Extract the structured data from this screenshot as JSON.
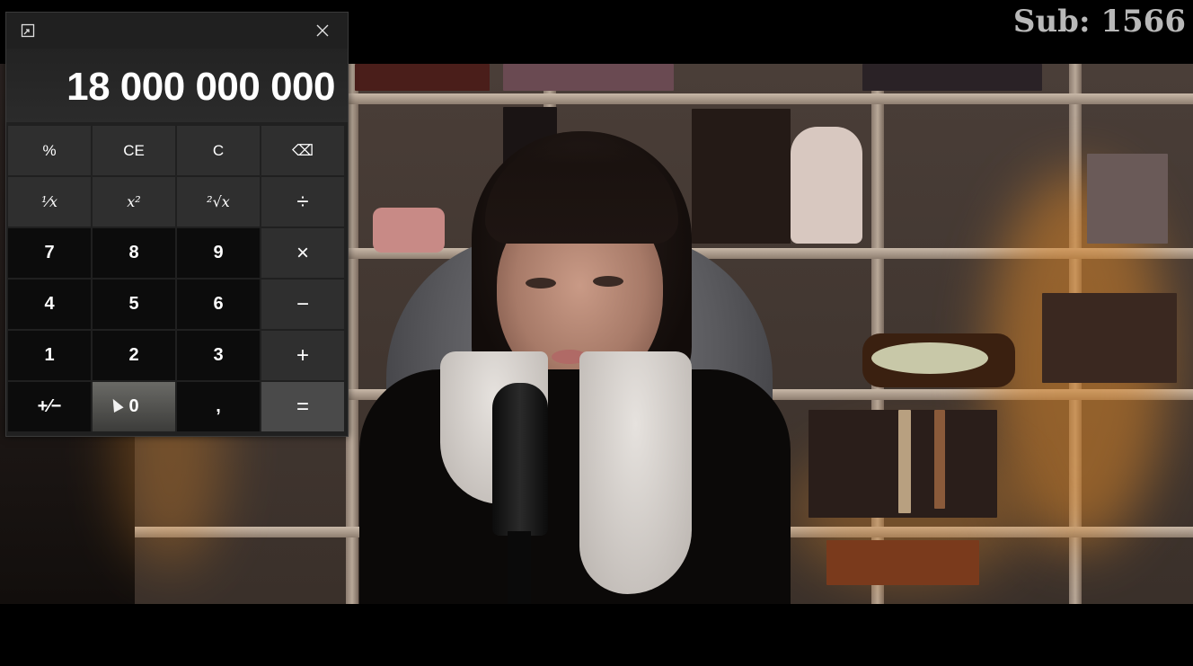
{
  "calculator": {
    "display_value": "18 000 000 000",
    "titlebar_icons": {
      "keep_on_top": "keep-on-top-icon",
      "close": "close-icon"
    },
    "keys": [
      {
        "id": "percent",
        "label": "%"
      },
      {
        "id": "clear-entry",
        "label": "CE"
      },
      {
        "id": "clear",
        "label": "C"
      },
      {
        "id": "backspace",
        "label": "⌫"
      },
      {
        "id": "reciprocal",
        "label": "¹⁄x"
      },
      {
        "id": "square",
        "label": "x²"
      },
      {
        "id": "square-root",
        "label": "²√x"
      },
      {
        "id": "divide",
        "label": "÷"
      },
      {
        "id": "7",
        "label": "7"
      },
      {
        "id": "8",
        "label": "8"
      },
      {
        "id": "9",
        "label": "9"
      },
      {
        "id": "multiply",
        "label": "×"
      },
      {
        "id": "4",
        "label": "4"
      },
      {
        "id": "5",
        "label": "5"
      },
      {
        "id": "6",
        "label": "6"
      },
      {
        "id": "subtract",
        "label": "−"
      },
      {
        "id": "1",
        "label": "1"
      },
      {
        "id": "2",
        "label": "2"
      },
      {
        "id": "3",
        "label": "3"
      },
      {
        "id": "add",
        "label": "+"
      },
      {
        "id": "negate",
        "label": "+⁄−"
      },
      {
        "id": "0",
        "label": "0"
      },
      {
        "id": "decimal",
        "label": ","
      },
      {
        "id": "equals",
        "label": "="
      }
    ]
  },
  "overlay": {
    "sub_label": "Sub:",
    "sub_count": "1566"
  },
  "colors": {
    "calc_bg": "#202020",
    "number_key": "#0c0c0c",
    "function_key": "#2f2f2f",
    "equals_key": "#4a4a4a",
    "overlay_text": "#b8b8b8"
  }
}
